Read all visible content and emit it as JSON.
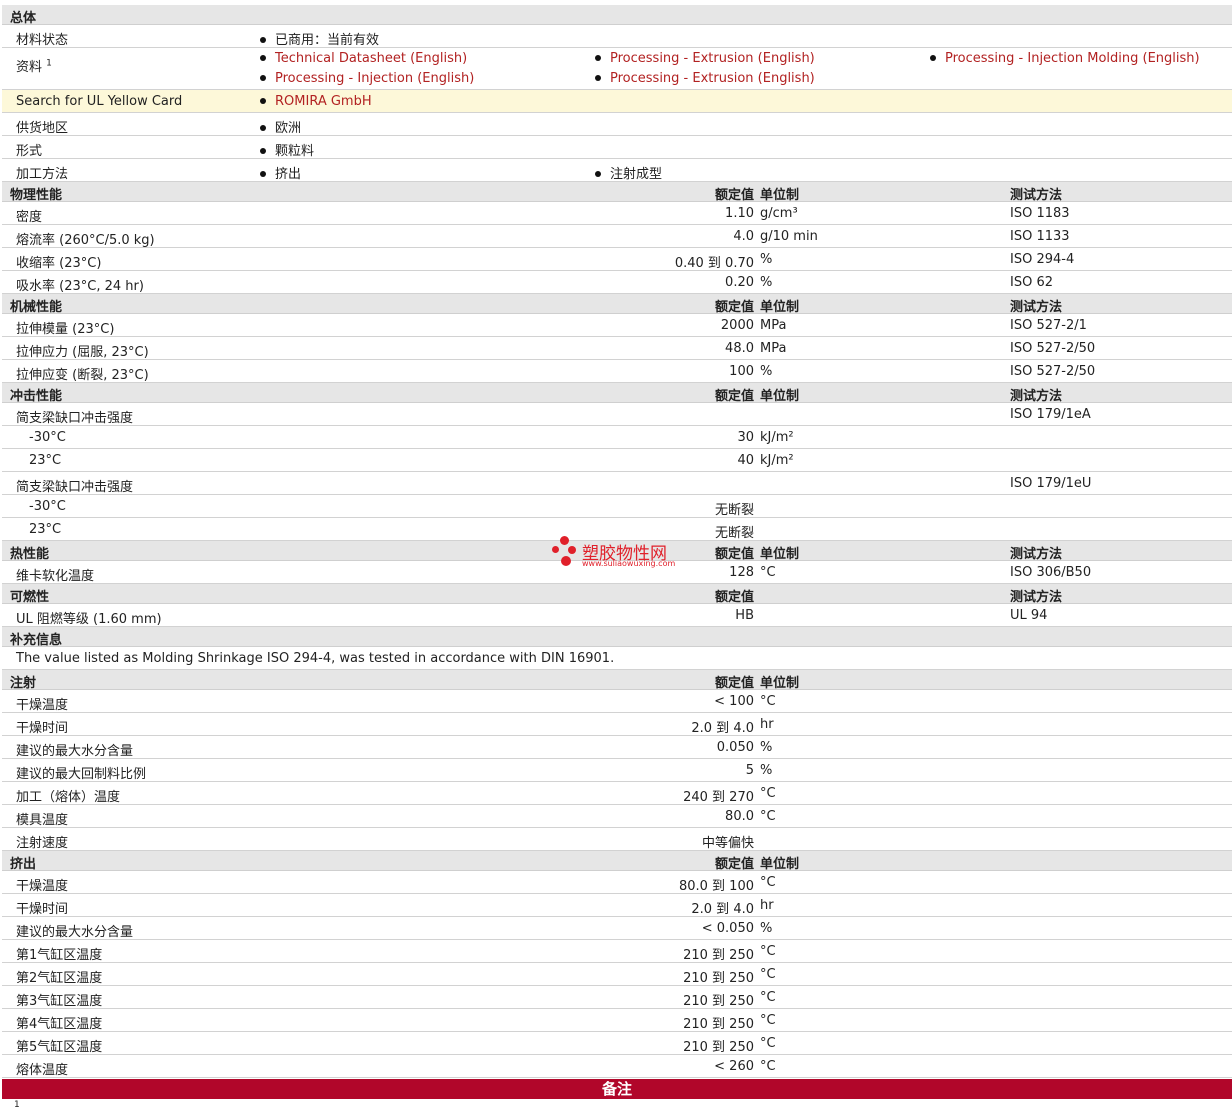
{
  "general": {
    "title": "总体",
    "status_label": "材料状态",
    "status_value": "已商用：当前有效",
    "docs_label": "资料",
    "docs_sup": "1",
    "docs": [
      "Technical Datasheet (English)",
      "Processing - Extrusion (English)",
      "Processing - Injection Molding (English)",
      "Processing - Injection (English)",
      "Processing - Extrusion (English)"
    ],
    "ul_label": "Search for UL Yellow Card",
    "ul_value": "ROMIRA GmbH",
    "region_label": "供货地区",
    "region_value": "欧洲",
    "form_label": "形式",
    "form_value": "颗粒料",
    "process_label": "加工方法",
    "process_values": [
      "挤出",
      "注射成型"
    ]
  },
  "headers": {
    "nominal": "额定值",
    "unit": "单位制",
    "method": "测试方法"
  },
  "physical": {
    "title": "物理性能",
    "rows": [
      {
        "label": "密度",
        "value": "1.10",
        "unit": "g/cm³",
        "method": "ISO 1183"
      },
      {
        "label": "熔流率  (260°C/5.0 kg)",
        "value": "4.0",
        "unit": "g/10 min",
        "method": "ISO 1133"
      },
      {
        "label": "收缩率  (23°C)",
        "value": "0.40 到  0.70",
        "unit": "%",
        "method": "ISO 294-4"
      },
      {
        "label": "吸水率  (23°C, 24 hr)",
        "value": "0.20",
        "unit": "%",
        "method": "ISO 62"
      }
    ]
  },
  "mechanical": {
    "title": "机械性能",
    "rows": [
      {
        "label": "拉伸模量  (23°C)",
        "value": "2000",
        "unit": "MPa",
        "method": "ISO 527-2/1"
      },
      {
        "label": "拉伸应力  (屈服, 23°C)",
        "value": "48.0",
        "unit": "MPa",
        "method": "ISO 527-2/50"
      },
      {
        "label": "拉伸应变  (断裂, 23°C)",
        "value": "100",
        "unit": "%",
        "method": "ISO 527-2/50"
      }
    ]
  },
  "impact": {
    "title": "冲击性能",
    "rows": [
      {
        "label": "简支梁缺口冲击强度",
        "value": "",
        "unit": "",
        "method": "ISO 179/1eA",
        "indent": false
      },
      {
        "label": "-30°C",
        "value": "30",
        "unit": "kJ/m²",
        "method": "",
        "indent": true
      },
      {
        "label": "23°C",
        "value": "40",
        "unit": "kJ/m²",
        "method": "",
        "indent": true
      },
      {
        "label": "简支梁缺口冲击强度",
        "value": "",
        "unit": "",
        "method": "ISO 179/1eU",
        "indent": false
      },
      {
        "label": "-30°C",
        "value": "无断裂",
        "unit": "",
        "method": "",
        "indent": true
      },
      {
        "label": "23°C",
        "value": "无断裂",
        "unit": "",
        "method": "",
        "indent": true
      }
    ]
  },
  "thermal": {
    "title": "热性能",
    "rows": [
      {
        "label": "维卡软化温度",
        "value": "128",
        "unit": "°C",
        "method": "ISO 306/B50"
      }
    ]
  },
  "flammability": {
    "title": "可燃性",
    "rows": [
      {
        "label": "UL 阻燃等级  (1.60 mm)",
        "value": "HB",
        "unit": "",
        "method": "UL 94"
      }
    ]
  },
  "supplement": {
    "title": "补充信息",
    "text": "The value listed as Molding Shrinkage ISO 294-4, was tested in accordance with DIN 16901."
  },
  "injection": {
    "title": "注射",
    "rows": [
      {
        "label": "干燥温度",
        "value": "< 100",
        "unit": "°C"
      },
      {
        "label": "干燥时间",
        "value": "2.0 到  4.0",
        "unit": "hr"
      },
      {
        "label": "建议的最大水分含量",
        "value": "0.050",
        "unit": "%"
      },
      {
        "label": "建议的最大回制料比例",
        "value": "5",
        "unit": "%"
      },
      {
        "label": "加工（熔体）温度",
        "value": "240 到  270",
        "unit": "°C"
      },
      {
        "label": "模具温度",
        "value": "80.0",
        "unit": "°C"
      },
      {
        "label": "注射速度",
        "value": "中等偏快",
        "unit": ""
      }
    ]
  },
  "extrusion": {
    "title": "挤出",
    "rows": [
      {
        "label": "干燥温度",
        "value": "80.0 到  100",
        "unit": "°C"
      },
      {
        "label": "干燥时间",
        "value": "2.0 到  4.0",
        "unit": "hr"
      },
      {
        "label": "建议的最大水分含量",
        "value": "< 0.050",
        "unit": "%"
      },
      {
        "label": "第1气缸区温度",
        "value": "210 到  250",
        "unit": "°C"
      },
      {
        "label": "第2气缸区温度",
        "value": "210 到  250",
        "unit": "°C"
      },
      {
        "label": "第3气缸区温度",
        "value": "210 到  250",
        "unit": "°C"
      },
      {
        "label": "第4气缸区温度",
        "value": "210 到  250",
        "unit": "°C"
      },
      {
        "label": "第5气缸区温度",
        "value": "210 到  250",
        "unit": "°C"
      },
      {
        "label": "熔体温度",
        "value": "< 260",
        "unit": "°C"
      }
    ]
  },
  "notes": {
    "title": "备注",
    "footnote_mark": "1"
  },
  "watermark": {
    "name": "塑胶物性网",
    "url": "www.suliaowuxing.com",
    "color": "#e0202a"
  }
}
